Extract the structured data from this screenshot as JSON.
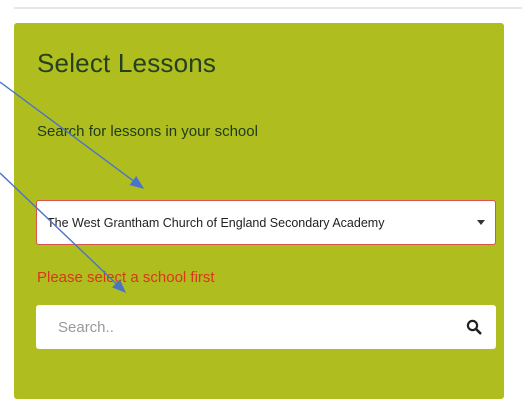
{
  "panel": {
    "title": "Select Lessons",
    "subtitle": "Search for lessons in your school",
    "school_select": {
      "value": "The West Grantham Church of England Secondary Academy"
    },
    "error": "Please select a school first",
    "search": {
      "placeholder": "Search.."
    }
  },
  "colors": {
    "panel_bg": "#afbe1e",
    "title_text": "#24401f",
    "error_text": "#d9361c",
    "select_border": "#d9534f",
    "annotation_arrow": "#4a74c9"
  },
  "icons": {
    "search": "search-icon",
    "select_caret": "chevron-down-icon"
  }
}
